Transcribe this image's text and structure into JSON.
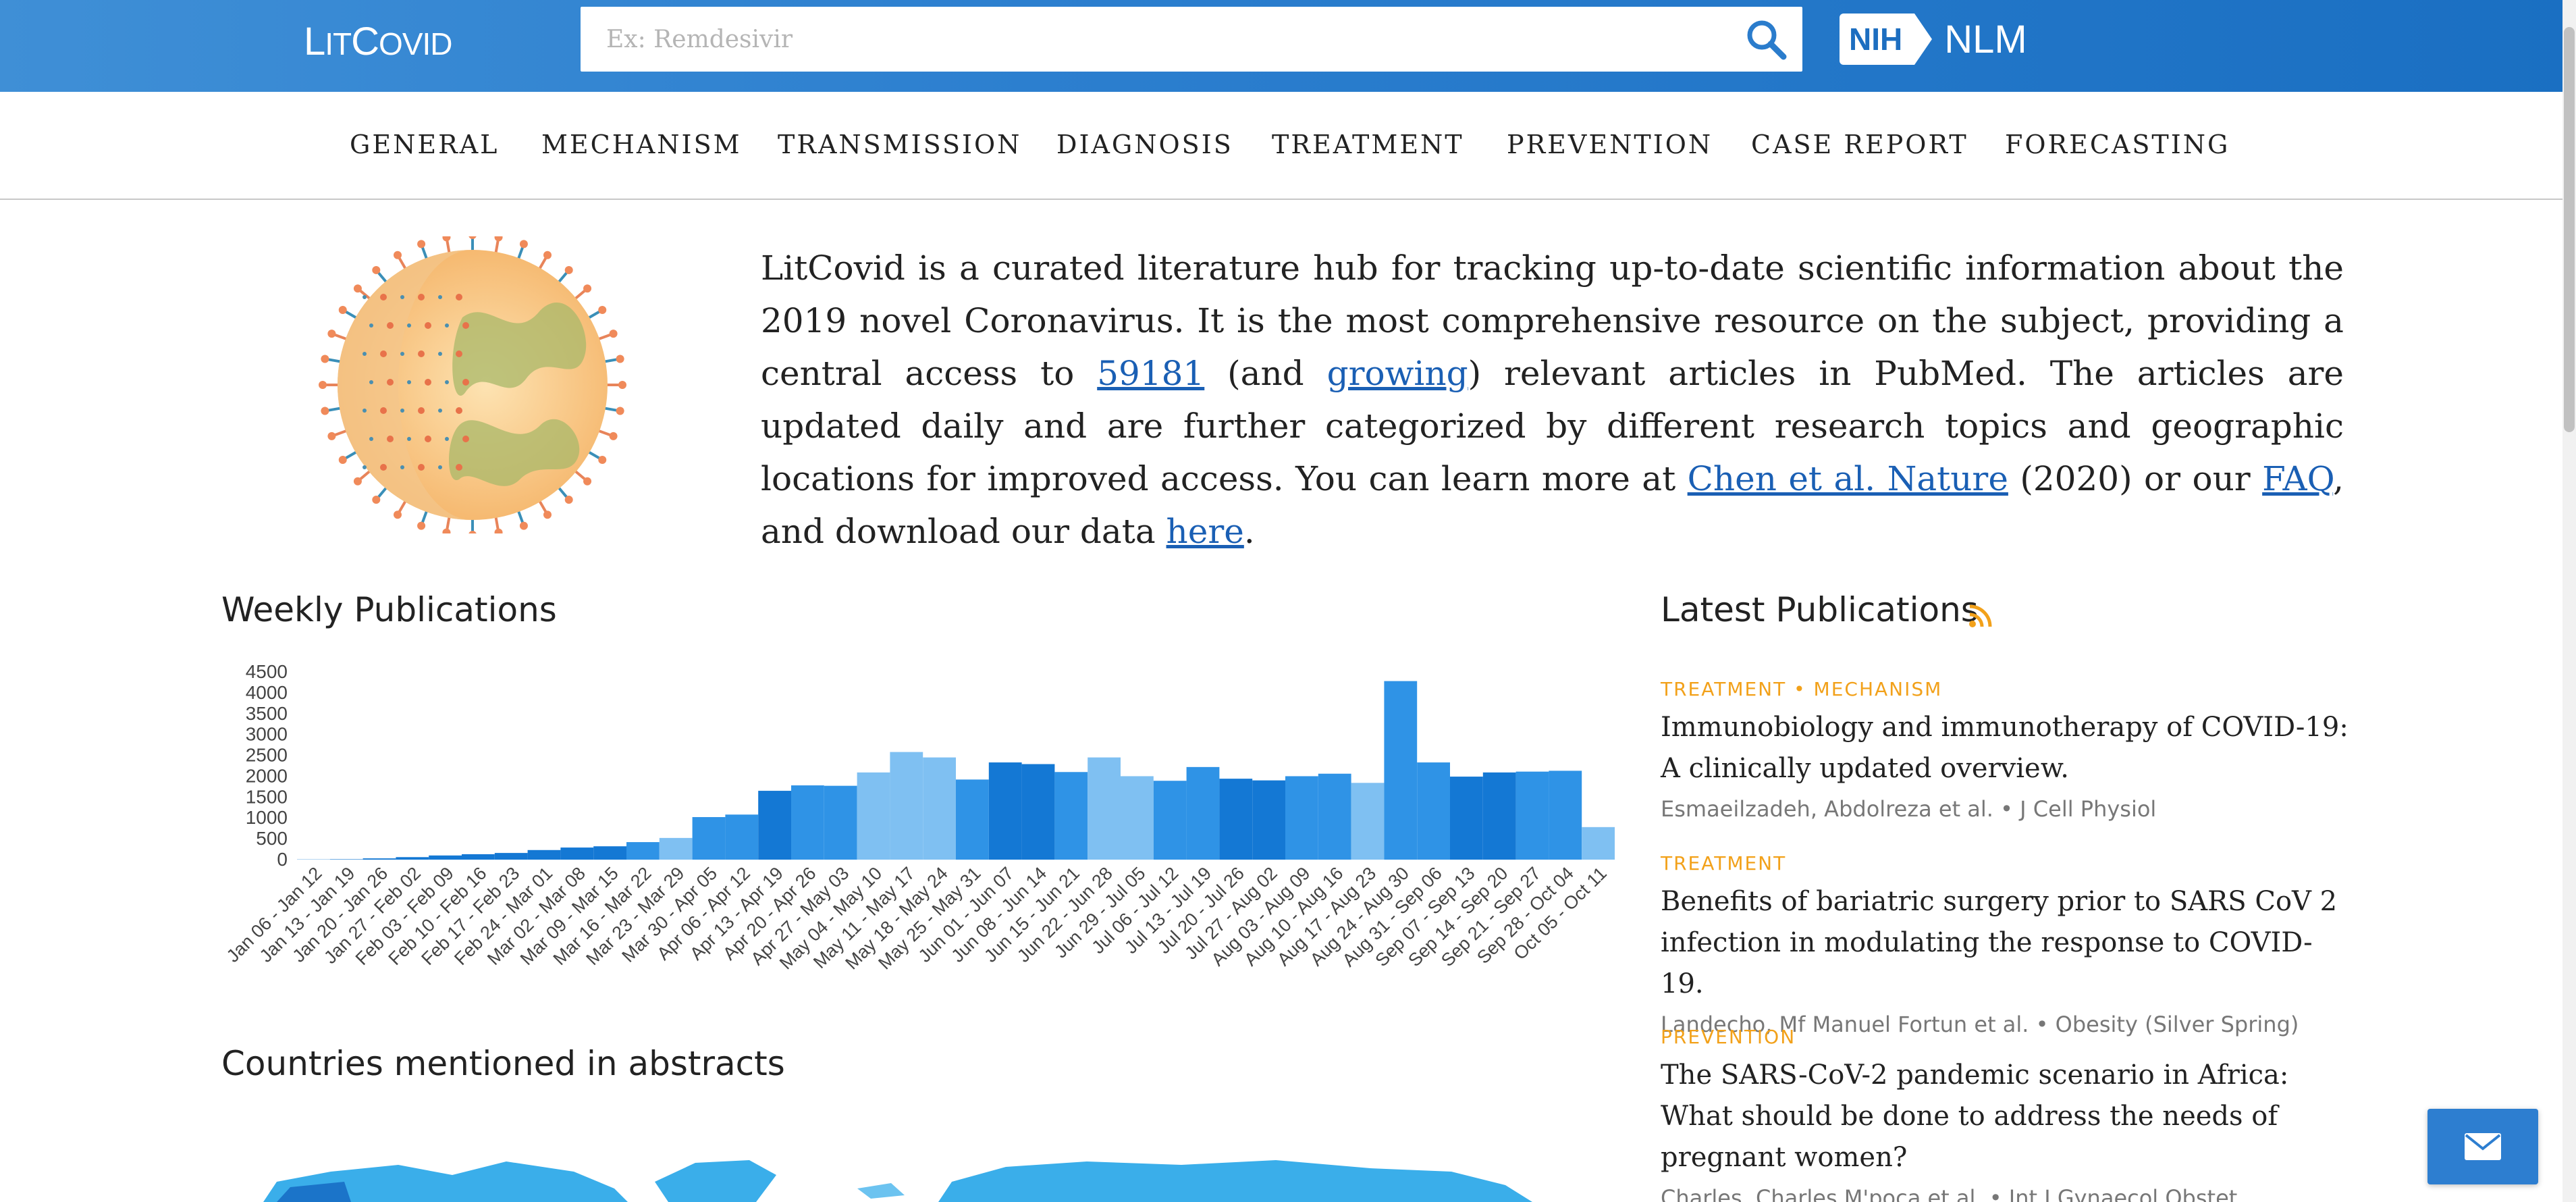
{
  "header": {
    "logo_lit": "L",
    "logo_it": "IT",
    "logo_covid": "C",
    "logo_ovid": "OVID",
    "search_placeholder": "Ex: Remdesivir",
    "nih_label": "NIH",
    "nlm_label": "NLM"
  },
  "nav": {
    "items": [
      "GENERAL",
      "MECHANISM",
      "TRANSMISSION",
      "DIAGNOSIS",
      "TREATMENT",
      "PREVENTION",
      "CASE REPORT",
      "FORECASTING"
    ]
  },
  "intro": {
    "part1": "LitCovid is a curated literature hub for tracking up-to-date scientific information about the 2019 novel Coronavirus. It is the most comprehensive resource on the subject, providing a central access to ",
    "count_link": "59181",
    "part2": " (and ",
    "growing_link": "growing",
    "part3": ") relevant articles in PubMed. The articles are updated daily and are further categorized by different research topics and geographic locations for improved access. You can learn more at ",
    "nature_link": "Chen et al. Nature",
    "part4": " (2020) or our ",
    "faq_link": "FAQ",
    "part5": ", and download our data ",
    "here_link": "here",
    "part6": "."
  },
  "weekly": {
    "title": "Weekly Publications"
  },
  "countries": {
    "title": "Countries mentioned in abstracts"
  },
  "latest": {
    "title": "Latest Publications",
    "items": [
      {
        "category": "TREATMENT • MECHANISM",
        "title": "Immunobiology and immunotherapy of COVID-19: A clinically updated overview.",
        "meta": "Esmaeilzadeh, Abdolreza et al. • J Cell Physiol"
      },
      {
        "category": "TREATMENT",
        "title": "Benefits of bariatric surgery prior to SARS CoV 2 infection in modulating the response to COVID-19.",
        "meta": "Landecho, Mf Manuel Fortun et al. • Obesity (Silver Spring)"
      },
      {
        "category": "PREVENTION",
        "title": "The SARS-CoV-2 pandemic scenario in Africa: What should be done to address the needs of pregnant women?",
        "meta": "Charles, Charles M'poca et al. • Int J Gynaecol Obstet"
      }
    ]
  },
  "colors": {
    "header": "#1a6fc2",
    "bar_dark": "#1478d4",
    "bar_mid": "#2f93e6",
    "bar_light": "#7fc0f2",
    "category_orange": "#f2a11a",
    "link_blue": "#1a5fb4",
    "map_blue": "#3aaeea"
  },
  "icons": {
    "search": "search-icon",
    "rss": "rss-icon",
    "email": "email-icon"
  },
  "chart_data": {
    "type": "bar",
    "title": "Weekly Publications",
    "xlabel": "",
    "ylabel": "",
    "ylim": [
      0,
      4500
    ],
    "yticks": [
      0,
      500,
      1000,
      1500,
      2000,
      2500,
      3000,
      3500,
      4000,
      4500
    ],
    "categories": [
      "Jan 06 - Jan 12",
      "Jan 13 - Jan 19",
      "Jan 20 - Jan 26",
      "Jan 27 - Feb 02",
      "Feb 03 - Feb 09",
      "Feb 10 - Feb 16",
      "Feb 17 - Feb 23",
      "Feb 24 - Mar 01",
      "Mar 02 - Mar 08",
      "Mar 09 - Mar 15",
      "Mar 16 - Mar 22",
      "Mar 23 - Mar 29",
      "Mar 30 - Apr 05",
      "Apr 06 - Apr 12",
      "Apr 13 - Apr 19",
      "Apr 20 - Apr 26",
      "Apr 27 - May 03",
      "May 04 - May 10",
      "May 11 - May 17",
      "May 18 - May 24",
      "May 25 - May 31",
      "Jun 01 - Jun 07",
      "Jun 08 - Jun 14",
      "Jun 15 - Jun 21",
      "Jun 22 - Jun 28",
      "Jun 29 - Jul 05",
      "Jul 06 - Jul 12",
      "Jul 13 - Jul 19",
      "Jul 20 - Jul 26",
      "Jul 27 - Aug 02",
      "Aug 03 - Aug 09",
      "Aug 10 - Aug 16",
      "Aug 17 - Aug 23",
      "Aug 24 - Aug 30",
      "Aug 31 - Sep 06",
      "Sep 07 - Sep 13",
      "Sep 14 - Sep 20",
      "Sep 21 - Sep 27",
      "Sep 28 - Oct 04",
      "Oct 05 - Oct 11"
    ],
    "values": [
      5,
      10,
      30,
      60,
      100,
      130,
      160,
      230,
      290,
      320,
      420,
      520,
      1020,
      1080,
      1650,
      1780,
      1770,
      2090,
      2580,
      2450,
      1920,
      2330,
      2290,
      2100,
      2450,
      2000,
      1890,
      2220,
      1940,
      1900,
      2000,
      2060,
      1840,
      4280,
      2330,
      1990,
      2090,
      2110,
      2130,
      780
    ],
    "shades": [
      "dark",
      "dark",
      "dark",
      "dark",
      "dark",
      "dark",
      "dark",
      "dark",
      "dark",
      "dark",
      "mid",
      "light",
      "mid",
      "mid",
      "dark",
      "mid",
      "mid",
      "light",
      "light",
      "light",
      "mid",
      "dark",
      "dark",
      "mid",
      "light",
      "light",
      "mid",
      "mid",
      "dark",
      "dark",
      "mid",
      "mid",
      "light",
      "mid",
      "mid",
      "dark",
      "dark",
      "mid",
      "mid",
      "light"
    ]
  }
}
